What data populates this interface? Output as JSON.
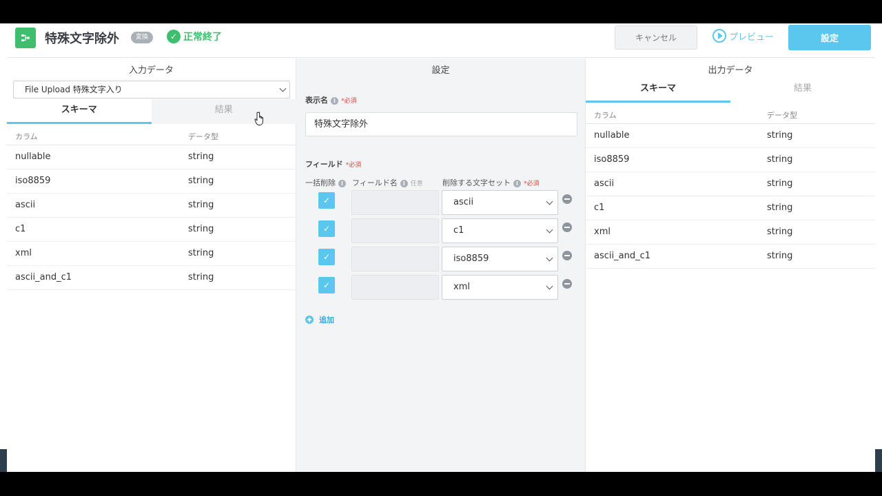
{
  "header": {
    "title": "特殊文字除外",
    "badge": "変換",
    "status": "正常終了",
    "cancel_label": "キャンセル",
    "preview_label": "プレビュー",
    "save_label": "設定"
  },
  "input_panel": {
    "title": "入力データ",
    "source_selected": "File Upload 特殊文字入り",
    "tabs": [
      "スキーマ",
      "結果"
    ],
    "col_header_name": "カラム",
    "col_header_type": "データ型",
    "rows": [
      {
        "name": "nullable",
        "type": "string"
      },
      {
        "name": "iso8859",
        "type": "string"
      },
      {
        "name": "ascii",
        "type": "string"
      },
      {
        "name": "c1",
        "type": "string"
      },
      {
        "name": "xml",
        "type": "string"
      },
      {
        "name": "ascii_and_c1",
        "type": "string"
      }
    ]
  },
  "settings_panel": {
    "title": "設定",
    "display_name_label": "表示名",
    "required_label": "*必須",
    "optional_label": "任意",
    "display_name_value": "特殊文字除外",
    "fields_label": "フィールド",
    "bulk_delete_label": "一括削除",
    "field_name_label": "フィールド名",
    "charset_label": "削除する文字セット",
    "field_rows": [
      {
        "checked": true,
        "field_name": "",
        "charset": "ascii"
      },
      {
        "checked": true,
        "field_name": "",
        "charset": "c1"
      },
      {
        "checked": true,
        "field_name": "",
        "charset": "iso8859"
      },
      {
        "checked": true,
        "field_name": "",
        "charset": "xml"
      }
    ],
    "add_label": "追加"
  },
  "output_panel": {
    "title": "出力データ",
    "tabs": [
      "スキーマ",
      "結果"
    ],
    "col_header_name": "カラム",
    "col_header_type": "データ型",
    "rows": [
      {
        "name": "nullable",
        "type": "string"
      },
      {
        "name": "iso8859",
        "type": "string"
      },
      {
        "name": "ascii",
        "type": "string"
      },
      {
        "name": "c1",
        "type": "string"
      },
      {
        "name": "xml",
        "type": "string"
      },
      {
        "name": "ascii_and_c1",
        "type": "string"
      }
    ]
  },
  "colors": {
    "accent": "#5bc7ee",
    "success": "#3fbf6e",
    "required": "#e0463c"
  }
}
